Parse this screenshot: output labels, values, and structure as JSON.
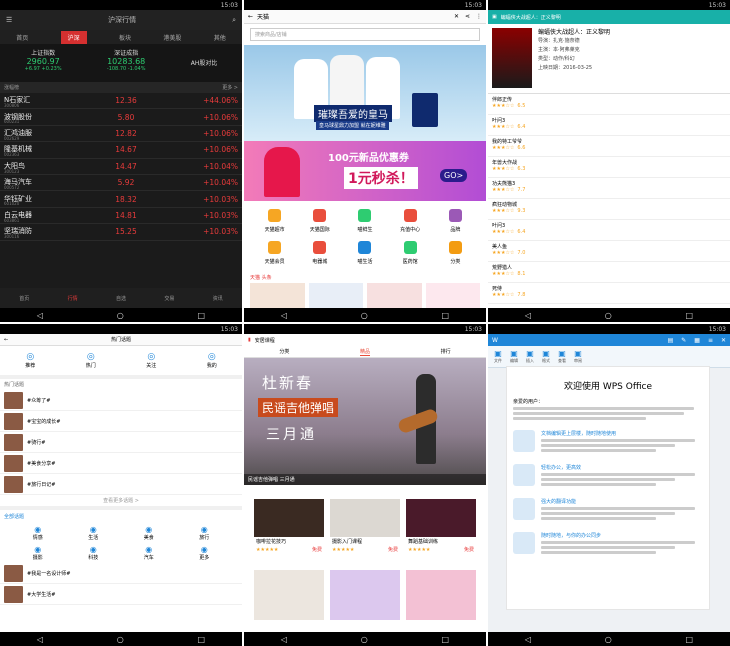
{
  "stock": {
    "title": "沪深行情",
    "tabs": [
      "首页",
      "沪深",
      "板块",
      "港美股",
      "其他"
    ],
    "indices": [
      {
        "name": "上证指数",
        "value": "2960.97",
        "change": "+6.97  +0.23%"
      },
      {
        "name": "深证成指",
        "value": "10283.68",
        "change": "-108.70  -1.04%"
      },
      {
        "name": "AH股对比"
      }
    ],
    "section": "涨幅榜",
    "more": "更多 >",
    "rows": [
      {
        "name": "N石家汇",
        "code": "300806",
        "price": "12.36",
        "change": "+44.06%"
      },
      {
        "name": "波钢股份",
        "code": "600231",
        "price": "5.80",
        "change": "+10.06%"
      },
      {
        "name": "汇鸿油服",
        "code": "002629",
        "price": "12.82",
        "change": "+10.06%"
      },
      {
        "name": "隆基机械",
        "code": "002363",
        "price": "14.67",
        "change": "+10.06%"
      },
      {
        "name": "大阳鸟",
        "code": "300123",
        "price": "14.47",
        "change": "+10.04%"
      },
      {
        "name": "海马汽车",
        "code": "000572",
        "price": "5.92",
        "change": "+10.04%"
      },
      {
        "name": "华钰矿业",
        "code": "601020",
        "price": "18.32",
        "change": "+10.03%"
      },
      {
        "name": "白云电器",
        "code": "603861",
        "price": "14.81",
        "change": "+10.03%"
      },
      {
        "name": "坚瑞消防",
        "code": "300116",
        "price": "15.25",
        "change": "+10.03%"
      }
    ],
    "bottom": [
      "首页",
      "行情",
      "自选",
      "交易",
      "资讯"
    ]
  },
  "tmall": {
    "title": "天猫",
    "search": "搜索商品/店铺",
    "banner1": "璀璨吾爱的皇马",
    "banner1_sub": "皇马球星鼎力加盟 就在妮维雅",
    "banner2_top": "100元新品优惠券",
    "banner2_big": "1元秒杀！",
    "banner2_go": "GO>",
    "icons": [
      "天猫超市",
      "天猫国际",
      "喵鲜生",
      "充值中心",
      "品牌",
      "天猫会员",
      "电器城",
      "喵生活",
      "医药馆",
      "分类"
    ],
    "strip": "天猫 头条"
  },
  "movie": {
    "title": "蝙蝠侠大战超人：正义黎明",
    "info": [
      "导演：扎克·施奈德",
      "主演：本·阿弗莱克",
      "类型：动作/科幻",
      "上映日期：2016-03-25"
    ],
    "list": [
      {
        "t": "伴郎正传",
        "s": "6.5"
      },
      {
        "t": "叶问3",
        "s": "6.4"
      },
      {
        "t": "我的特工爷爷",
        "s": "6.6"
      },
      {
        "t": "年兽大作战",
        "s": "6.3"
      },
      {
        "t": "功夫熊猫3",
        "s": "7.7"
      },
      {
        "t": "疯狂动物城",
        "s": "9.3"
      },
      {
        "t": "叶问3",
        "s": "6.4"
      },
      {
        "t": "美人鱼",
        "s": "7.0"
      },
      {
        "t": "荒野猎人",
        "s": "8.1"
      },
      {
        "t": "死侍",
        "s": "7.8"
      }
    ]
  },
  "forum": {
    "title": "热门话题",
    "cats": [
      "推荐",
      "热门",
      "关注",
      "我的"
    ],
    "list_head": "热门话题",
    "posts": [
      "#众筹了#",
      "#宝宝的成长#",
      "#骑行#",
      "#美食分享#",
      "#旅行日记#"
    ],
    "more": "查看更多话题 >",
    "sec2": "全部话题",
    "grid": [
      "情感",
      "生活",
      "美食",
      "旅行",
      "摄影",
      "科技",
      "汽车",
      "更多"
    ],
    "post2": "#我是一名设计师#",
    "post3": "#大学生活#"
  },
  "course": {
    "title": "安居课程",
    "tabs": [
      "分类",
      "精品",
      "排行"
    ],
    "hero_title": "杜新春",
    "hero_sub": "民谣吉他弹唱",
    "hero_tag": "三月通",
    "hero_caption": "民谣吉他弹唱 三月通",
    "cards": [
      {
        "t": "咖啡拉花技巧",
        "p": "免费"
      },
      {
        "t": "摄影入门课程",
        "p": "免费"
      },
      {
        "t": "舞蹈基础训练",
        "p": "免费"
      }
    ]
  },
  "wps": {
    "app": "WPS Office",
    "doc_title": "欢迎使用 WPS Office",
    "greeting": "亲爱的用户：",
    "items": [
      "文档编辑更上层楼，随时随地使用",
      "轻松办公，更高效",
      "强大的翻译功能",
      "随时随地，与你的办公同步"
    ],
    "ribbon": [
      "文件",
      "编辑",
      "插入",
      "格式",
      "查看",
      "审阅"
    ]
  },
  "status_time": "15:03",
  "colors": {
    "red": "#e83b3b",
    "green": "#2ecc71",
    "teal": "#18b0a8",
    "wps": "#1f86d8"
  }
}
